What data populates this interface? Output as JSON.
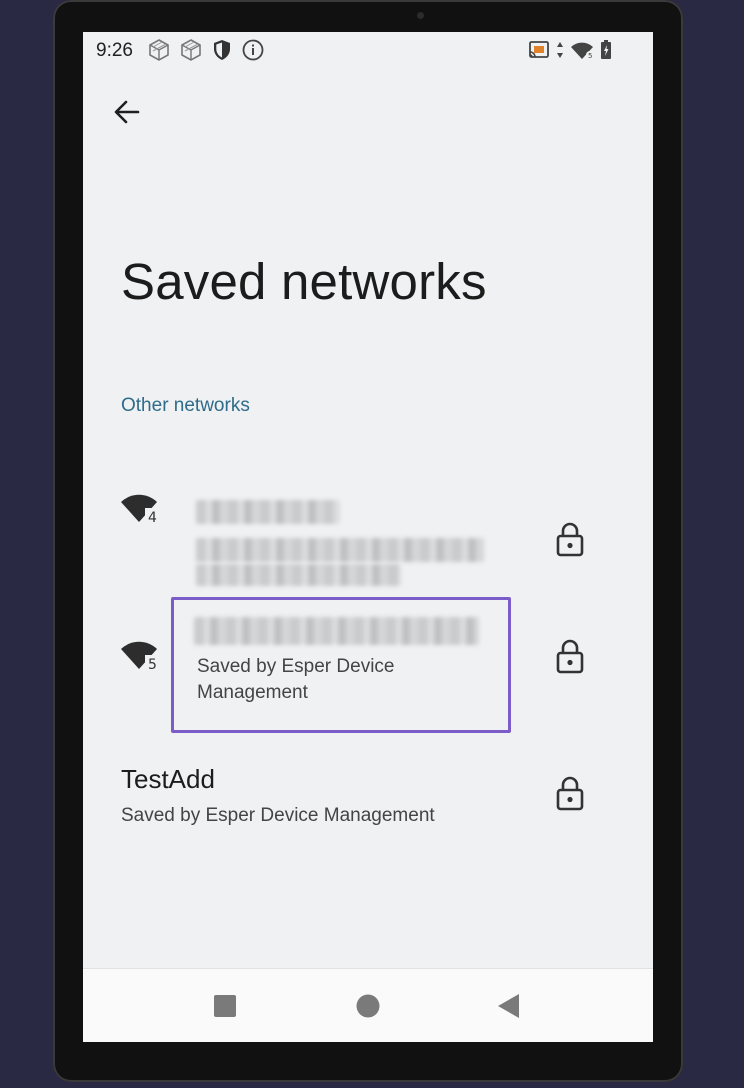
{
  "status_bar": {
    "time": "9:26"
  },
  "header": {
    "title": "Saved networks"
  },
  "section": {
    "label": "Other networks"
  },
  "networks": [
    {
      "signal_badge": "4",
      "summary": ""
    },
    {
      "signal_badge": "5",
      "summary": "Saved by Esper Device Management"
    },
    {
      "name": "TestAdd",
      "summary": "Saved by Esper Device Management"
    }
  ],
  "colors": {
    "accent": "#2f6b8a",
    "highlight": "#7b5cc8",
    "background": "#eff1f2"
  },
  "icons": {
    "back": "arrow-left-icon",
    "wifi": "wifi-icon",
    "lock": "lock-icon",
    "nav_recents": "square-icon",
    "nav_home": "circle-icon",
    "nav_back": "triangle-icon"
  }
}
